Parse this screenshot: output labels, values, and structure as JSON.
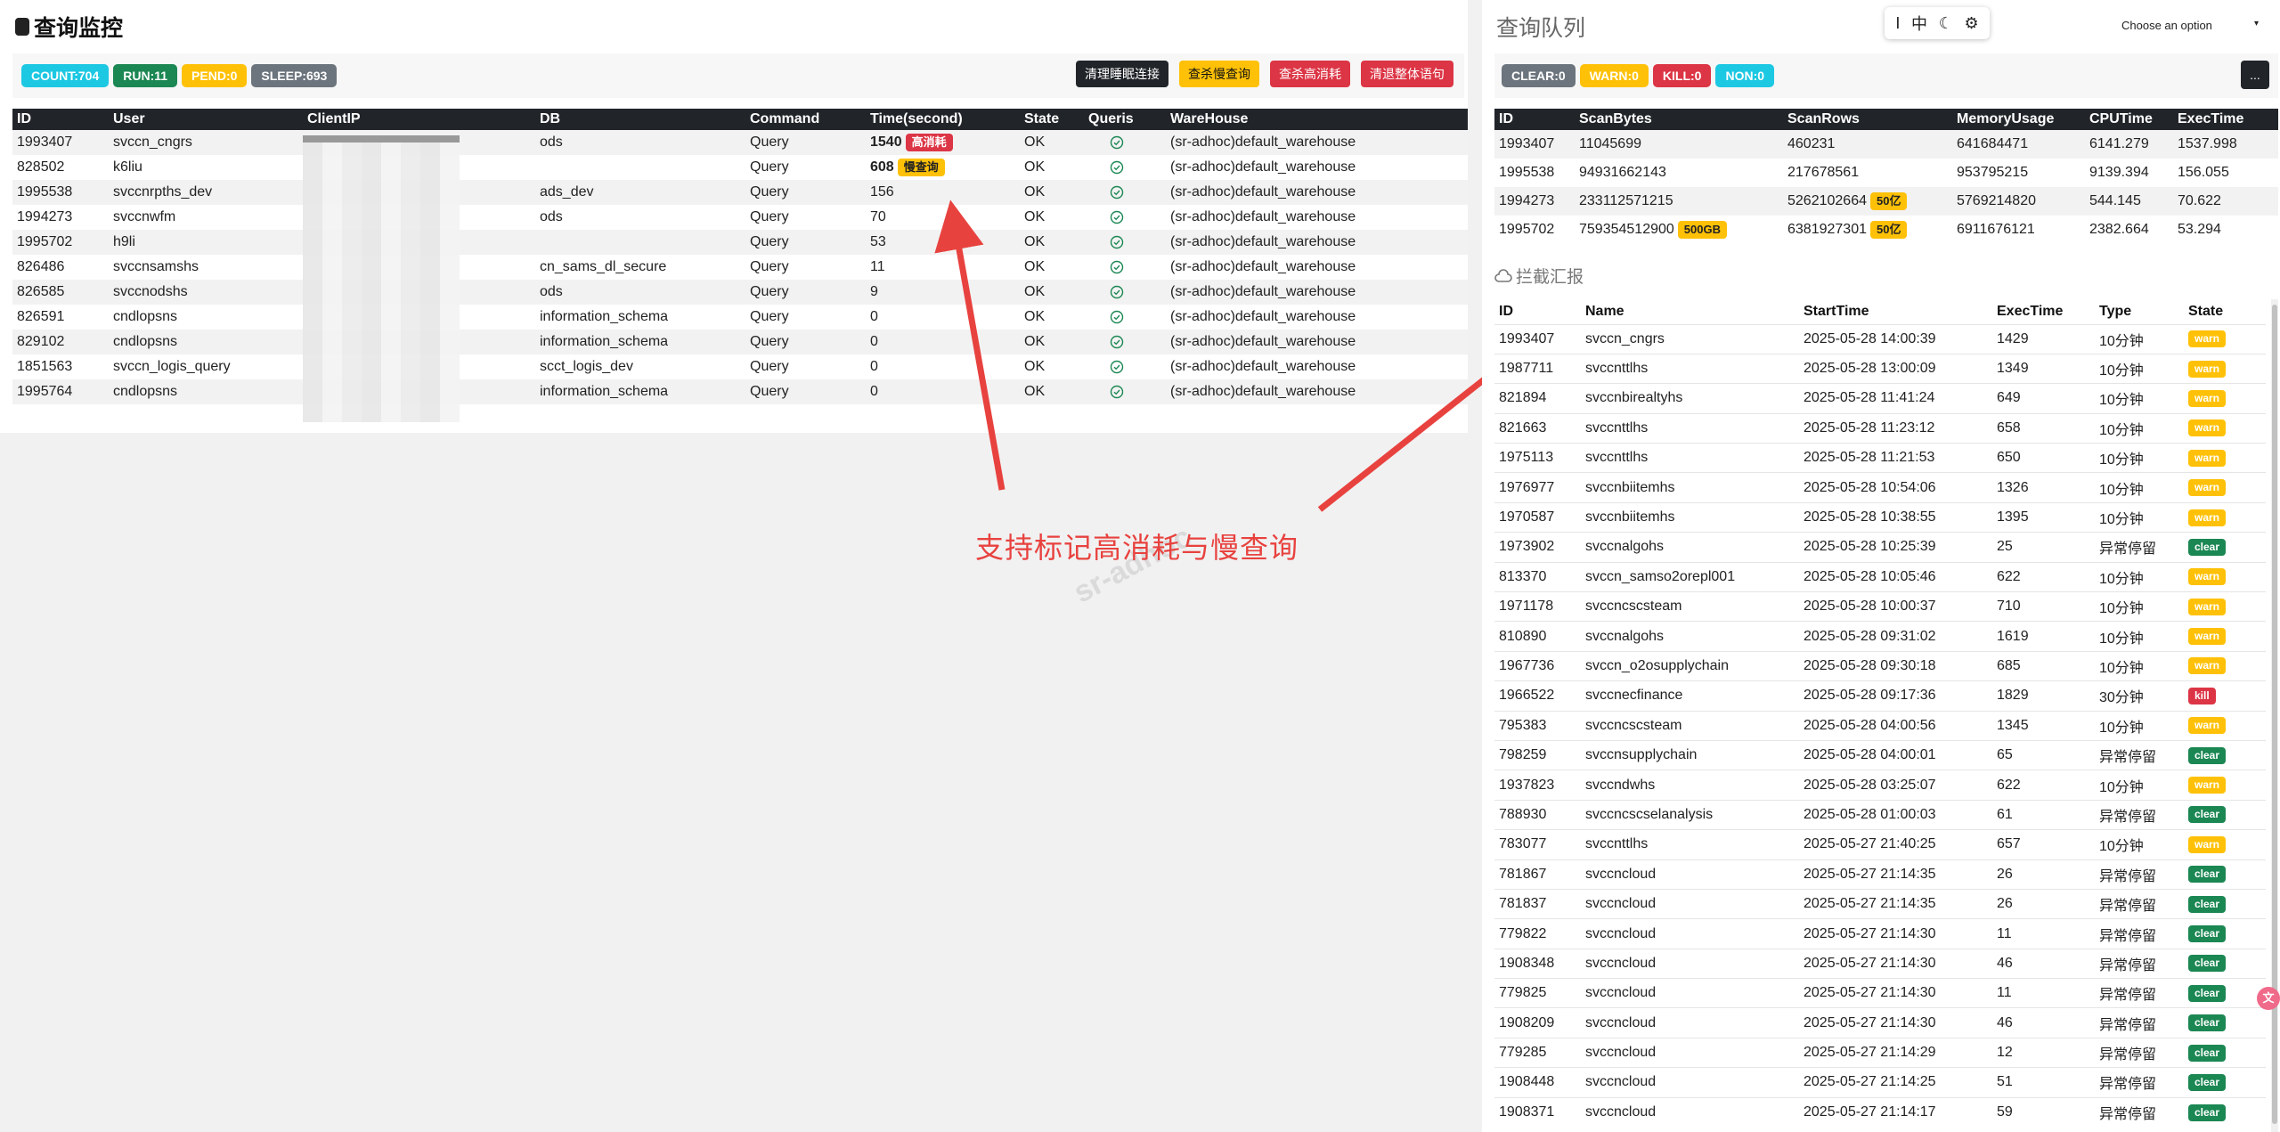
{
  "left": {
    "title": "查询监控",
    "badges": [
      {
        "label": "COUNT:704",
        "color": "#1dc8e2"
      },
      {
        "label": "RUN:11",
        "color": "#1b8753"
      },
      {
        "label": "PEND:0",
        "color": "#ffc107"
      },
      {
        "label": "SLEEP:693",
        "color": "#6c757d"
      }
    ],
    "actions": [
      "清理睡眠连接",
      "查杀慢查询",
      "查杀高消耗",
      "清退整体语句"
    ],
    "columns": [
      "ID",
      "User",
      "ClientIP",
      "DB",
      "Command",
      "Time(second)",
      "State",
      "Queris",
      "WareHouse"
    ],
    "rows": [
      {
        "id": "1993407",
        "user": "svccn_cngrs",
        "ip": "",
        "db": "ods",
        "cmd": "Query",
        "time": "1540",
        "tag": "高消耗",
        "tag_color": "red",
        "state": "OK",
        "wh": "(sr-adhoc)default_warehouse"
      },
      {
        "id": "828502",
        "user": "k6liu",
        "ip": "",
        "db": "",
        "cmd": "Query",
        "time": "608",
        "tag": "慢查询",
        "tag_color": "yellow",
        "state": "OK",
        "wh": "(sr-adhoc)default_warehouse"
      },
      {
        "id": "1995538",
        "user": "svccnrpths_dev",
        "ip": "",
        "db": "ads_dev",
        "cmd": "Query",
        "time": "156",
        "tag": "",
        "tag_color": "",
        "state": "OK",
        "wh": "(sr-adhoc)default_warehouse"
      },
      {
        "id": "1994273",
        "user": "svccnwfm",
        "ip": "",
        "db": "ods",
        "cmd": "Query",
        "time": "70",
        "tag": "",
        "tag_color": "",
        "state": "OK",
        "wh": "(sr-adhoc)default_warehouse"
      },
      {
        "id": "1995702",
        "user": "h9li",
        "ip": "",
        "db": "",
        "cmd": "Query",
        "time": "53",
        "tag": "",
        "tag_color": "",
        "state": "OK",
        "wh": "(sr-adhoc)default_warehouse"
      },
      {
        "id": "826486",
        "user": "svccnsamshs",
        "ip": "",
        "db": "cn_sams_dl_secure",
        "cmd": "Query",
        "time": "11",
        "tag": "",
        "tag_color": "",
        "state": "OK",
        "wh": "(sr-adhoc)default_warehouse"
      },
      {
        "id": "826585",
        "user": "svccnodshs",
        "ip": "",
        "db": "ods",
        "cmd": "Query",
        "time": "9",
        "tag": "",
        "tag_color": "",
        "state": "OK",
        "wh": "(sr-adhoc)default_warehouse"
      },
      {
        "id": "826591",
        "user": "cndlopsns",
        "ip": "",
        "db": "information_schema",
        "cmd": "Query",
        "time": "0",
        "tag": "",
        "tag_color": "",
        "state": "OK",
        "wh": "(sr-adhoc)default_warehouse"
      },
      {
        "id": "829102",
        "user": "cndlopsns",
        "ip": "",
        "db": "information_schema",
        "cmd": "Query",
        "time": "0",
        "tag": "",
        "tag_color": "",
        "state": "OK",
        "wh": "(sr-adhoc)default_warehouse"
      },
      {
        "id": "1851563",
        "user": "svccn_logis_query",
        "ip": "",
        "db": "scct_logis_dev",
        "cmd": "Query",
        "time": "0",
        "tag": "",
        "tag_color": "",
        "state": "OK",
        "wh": "(sr-adhoc)default_warehouse"
      },
      {
        "id": "1995764",
        "user": "cndlopsns",
        "ip": "",
        "db": "information_schema",
        "cmd": "Query",
        "time": "0",
        "tag": "",
        "tag_color": "",
        "state": "OK",
        "wh": "(sr-adhoc)default_warehouse"
      }
    ]
  },
  "annotation": "支持标记高消耗与慢查询",
  "watermark": "sr-adhoc",
  "right": {
    "title": "查询队列",
    "toolbar": [
      "I",
      "中",
      "☾",
      "⚙"
    ],
    "select_value": "Choose an option",
    "badges": [
      {
        "label": "CLEAR:0",
        "color": "#6c757d"
      },
      {
        "label": "WARN:0",
        "color": "#ffc107"
      },
      {
        "label": "KILL:0",
        "color": "#dc3545"
      },
      {
        "label": "NON:0",
        "color": "#1dc8e2"
      }
    ],
    "more_label": "...",
    "queue_columns": [
      "ID",
      "ScanBytes",
      "ScanRows",
      "MemoryUsage",
      "CPUTime",
      "ExecTime"
    ],
    "queue_rows": [
      {
        "id": "1993407",
        "bytes": "11045699",
        "bytes_tag": "",
        "rows": "460231",
        "rows_tag": "",
        "mem": "641684471",
        "cpu": "6141.279",
        "exec": "1537.998"
      },
      {
        "id": "1995538",
        "bytes": "94931662143",
        "bytes_tag": "",
        "rows": "217678561",
        "rows_tag": "",
        "mem": "953795215",
        "cpu": "9139.394",
        "exec": "156.055"
      },
      {
        "id": "1994273",
        "bytes": "233112571215",
        "bytes_tag": "",
        "rows": "5262102664",
        "rows_tag": "50亿",
        "mem": "5769214820",
        "cpu": "544.145",
        "exec": "70.622"
      },
      {
        "id": "1995702",
        "bytes": "759354512900",
        "bytes_tag": "500GB",
        "rows": "6381927301",
        "rows_tag": "50亿",
        "mem": "6911676121",
        "cpu": "2382.664",
        "exec": "53.294"
      }
    ],
    "report_title": "拦截汇报",
    "report_columns": [
      "ID",
      "Name",
      "StartTime",
      "ExecTime",
      "Type",
      "State"
    ],
    "report_rows": [
      {
        "id": "1993407",
        "name": "svccn_cngrs",
        "start": "2025-05-28 14:00:39",
        "exec": "1429",
        "type": "10分钟",
        "state": "warn"
      },
      {
        "id": "1987711",
        "name": "svccnttlhs",
        "start": "2025-05-28 13:00:09",
        "exec": "1349",
        "type": "10分钟",
        "state": "warn"
      },
      {
        "id": "821894",
        "name": "svccnbirealtyhs",
        "start": "2025-05-28 11:41:24",
        "exec": "649",
        "type": "10分钟",
        "state": "warn"
      },
      {
        "id": "821663",
        "name": "svccnttlhs",
        "start": "2025-05-28 11:23:12",
        "exec": "658",
        "type": "10分钟",
        "state": "warn"
      },
      {
        "id": "1975113",
        "name": "svccnttlhs",
        "start": "2025-05-28 11:21:53",
        "exec": "650",
        "type": "10分钟",
        "state": "warn"
      },
      {
        "id": "1976977",
        "name": "svccnbiitemhs",
        "start": "2025-05-28 10:54:06",
        "exec": "1326",
        "type": "10分钟",
        "state": "warn"
      },
      {
        "id": "1970587",
        "name": "svccnbiitemhs",
        "start": "2025-05-28 10:38:55",
        "exec": "1395",
        "type": "10分钟",
        "state": "warn"
      },
      {
        "id": "1973902",
        "name": "svccnalgohs",
        "start": "2025-05-28 10:25:39",
        "exec": "25",
        "type": "异常停留",
        "state": "clear"
      },
      {
        "id": "813370",
        "name": "svccn_samso2orepl001",
        "start": "2025-05-28 10:05:46",
        "exec": "622",
        "type": "10分钟",
        "state": "warn"
      },
      {
        "id": "1971178",
        "name": "svccncscsteam",
        "start": "2025-05-28 10:00:37",
        "exec": "710",
        "type": "10分钟",
        "state": "warn"
      },
      {
        "id": "810890",
        "name": "svccnalgohs",
        "start": "2025-05-28 09:31:02",
        "exec": "1619",
        "type": "10分钟",
        "state": "warn"
      },
      {
        "id": "1967736",
        "name": "svccn_o2osupplychain",
        "start": "2025-05-28 09:30:18",
        "exec": "685",
        "type": "10分钟",
        "state": "warn"
      },
      {
        "id": "1966522",
        "name": "svccnecfinance",
        "start": "2025-05-28 09:17:36",
        "exec": "1829",
        "type": "30分钟",
        "state": "kill"
      },
      {
        "id": "795383",
        "name": "svccncscsteam",
        "start": "2025-05-28 04:00:56",
        "exec": "1345",
        "type": "10分钟",
        "state": "warn"
      },
      {
        "id": "798259",
        "name": "svccnsupplychain",
        "start": "2025-05-28 04:00:01",
        "exec": "65",
        "type": "异常停留",
        "state": "clear"
      },
      {
        "id": "1937823",
        "name": "svccndwhs",
        "start": "2025-05-28 03:25:07",
        "exec": "622",
        "type": "10分钟",
        "state": "warn"
      },
      {
        "id": "788930",
        "name": "svccncscselanalysis",
        "start": "2025-05-28 01:00:03",
        "exec": "61",
        "type": "异常停留",
        "state": "clear"
      },
      {
        "id": "783077",
        "name": "svccnttlhs",
        "start": "2025-05-27 21:40:25",
        "exec": "657",
        "type": "10分钟",
        "state": "warn"
      },
      {
        "id": "781867",
        "name": "svccncloud",
        "start": "2025-05-27 21:14:35",
        "exec": "26",
        "type": "异常停留",
        "state": "clear"
      },
      {
        "id": "781837",
        "name": "svccncloud",
        "start": "2025-05-27 21:14:35",
        "exec": "26",
        "type": "异常停留",
        "state": "clear"
      },
      {
        "id": "779822",
        "name": "svccncloud",
        "start": "2025-05-27 21:14:30",
        "exec": "11",
        "type": "异常停留",
        "state": "clear"
      },
      {
        "id": "1908348",
        "name": "svccncloud",
        "start": "2025-05-27 21:14:30",
        "exec": "46",
        "type": "异常停留",
        "state": "clear"
      },
      {
        "id": "779825",
        "name": "svccncloud",
        "start": "2025-05-27 21:14:30",
        "exec": "11",
        "type": "异常停留",
        "state": "clear"
      },
      {
        "id": "1908209",
        "name": "svccncloud",
        "start": "2025-05-27 21:14:30",
        "exec": "46",
        "type": "异常停留",
        "state": "clear"
      },
      {
        "id": "779285",
        "name": "svccncloud",
        "start": "2025-05-27 21:14:29",
        "exec": "12",
        "type": "异常停留",
        "state": "clear"
      },
      {
        "id": "1908448",
        "name": "svccncloud",
        "start": "2025-05-27 21:14:25",
        "exec": "51",
        "type": "异常停留",
        "state": "clear"
      },
      {
        "id": "1908371",
        "name": "svccncloud",
        "start": "2025-05-27 21:14:17",
        "exec": "59",
        "type": "异常停留",
        "state": "clear"
      }
    ]
  }
}
